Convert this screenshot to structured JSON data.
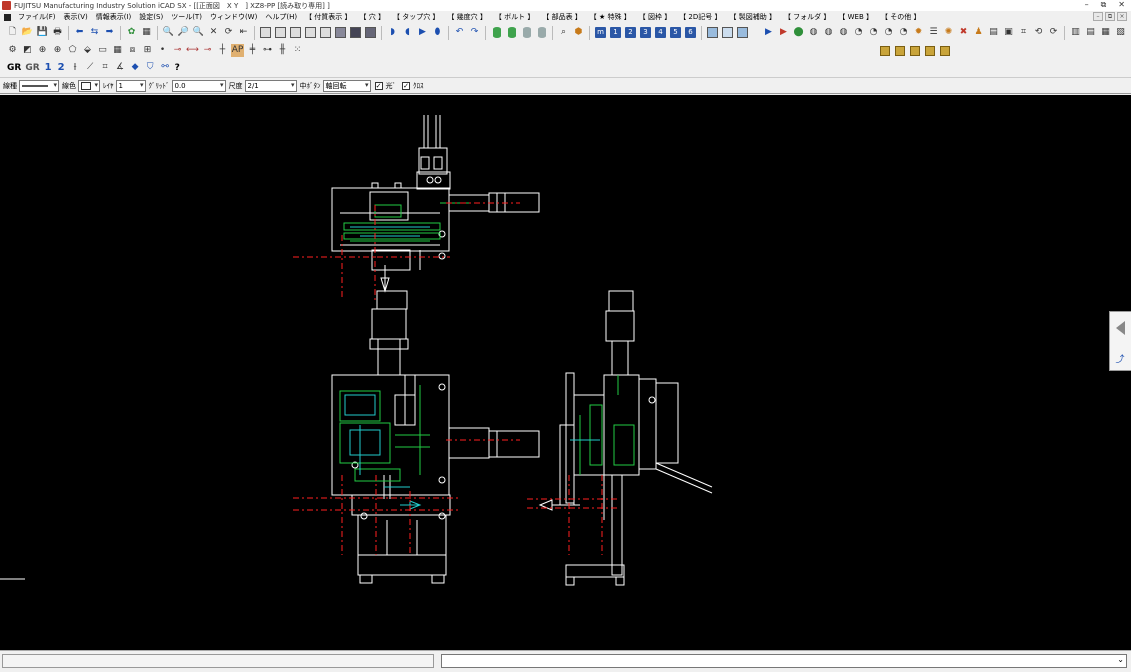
{
  "window": {
    "title": "FUJITSU Manufacturing Industry Solution iCAD SX - [[正面図　X Y　] XZ8-PP [読み取り専用] ]",
    "controls": [
      "–",
      "⧉",
      "✕"
    ],
    "mdi_controls": [
      "–",
      "⧉",
      "×"
    ]
  },
  "menubar": {
    "items": [
      "ファイル(F)",
      "表示(V)",
      "情報表示(I)",
      "設定(S)",
      "ツール(T)",
      "ウィンドウ(W)",
      "ヘルプ(H)",
      "【 付質表示 】",
      "【 穴 】",
      "【 タップ穴 】",
      "【 幾度穴 】",
      "【 ボルト 】",
      "【 部品表 】",
      "【 ★ 特殊 】",
      "【 図枠 】",
      "【 2D記号 】",
      "【 製図補助 】",
      "【 フォルダ 】",
      "【 WEB 】",
      "【 その他 】"
    ]
  },
  "toolbar3": {
    "gr1": "GR",
    "gr2": "GR",
    "n1": "1",
    "n2": "2",
    "help": "?"
  },
  "propbar": {
    "line_type_label": "線種",
    "line_color_label": "線色",
    "layer_label": "ﾚｲﾔ",
    "layer_value": "1",
    "grid_label": "ｸﾞﾘｯﾄﾞ",
    "grid_value": "0.0",
    "scale_label": "尺度",
    "scale_value": "2/1",
    "middle_button_label": "中ﾎﾞﾀﾝ",
    "middle_button_value": "軸回転",
    "light_label": "光ﾞ",
    "cross_label": "ｸﾛｽ",
    "light_checked": true,
    "cross_checked": true
  },
  "toolbar_numbers": [
    "1",
    "2",
    "3",
    "4",
    "5",
    "6"
  ],
  "colors": {
    "canvas": "#000000",
    "line_white": "#ffffff",
    "line_red": "#ff2020",
    "line_green": "#22cc44",
    "line_cyan": "#22cccc"
  },
  "icons": {
    "toolbar1": [
      "new-icon",
      "open-icon",
      "save-icon",
      "print-icon",
      "undo-arrow-icon",
      "swap-arrow-icon",
      "redo-arrow-icon",
      "zoom-in-icon",
      "zoom-icon",
      "zoom-out-icon",
      "zoom-fit-icon",
      "rotate-icon",
      "pan-icon",
      "view-front-icon",
      "view-top-icon",
      "view-right-icon",
      "view-iso-icon",
      "shade-icon",
      "cylinder-icon",
      "layer-numbers-icon",
      "run-icon",
      "stop-icon",
      "globe-icon",
      "delete-icon"
    ],
    "toolbar2": [
      "select-icon",
      "snap-icon",
      "center-icon",
      "polygon-icon",
      "fill-icon",
      "dimension-icon",
      "grid-icon"
    ]
  }
}
